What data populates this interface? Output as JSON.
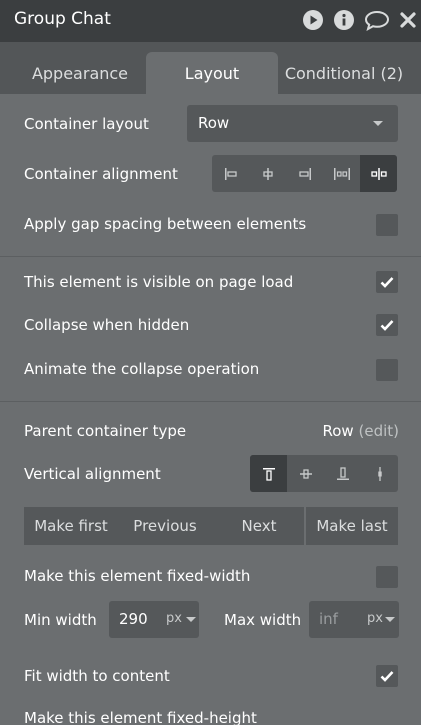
{
  "header": {
    "title": "Group Chat",
    "icons": [
      "play-icon",
      "info-icon",
      "comment-icon",
      "close-icon"
    ]
  },
  "tabs": [
    {
      "label": "Appearance",
      "active": false
    },
    {
      "label": "Layout",
      "active": true
    },
    {
      "label": "Conditional (2)",
      "active": false
    }
  ],
  "container": {
    "layout_label": "Container layout",
    "layout_value": "Row",
    "alignment_label": "Container alignment",
    "alignment_options": [
      "align-left-icon",
      "align-center-icon",
      "align-right-icon",
      "space-between-icon",
      "space-around-icon"
    ],
    "alignment_selected": "space-around-icon",
    "gap_label": "Apply gap spacing between elements",
    "gap_checked": false
  },
  "visibility": {
    "visible_label": "This element is visible on page load",
    "visible_checked": true,
    "collapse_label": "Collapse when hidden",
    "collapse_checked": true,
    "animate_label": "Animate the collapse operation",
    "animate_checked": false
  },
  "parent": {
    "type_label": "Parent container type",
    "type_value": "Row",
    "edit_label": "(edit)",
    "valign_label": "Vertical alignment",
    "valign_options": [
      "align-top-icon",
      "align-middle-icon",
      "align-bottom-icon",
      "align-stretch-icon"
    ],
    "valign_selected": "align-top-icon"
  },
  "order_buttons": [
    "Make first",
    "Previous",
    "Next",
    "Make last"
  ],
  "width": {
    "fixed_label": "Make this element fixed-width",
    "fixed_checked": false,
    "min_label": "Min width",
    "min_value": "290",
    "min_unit": "px",
    "max_label": "Max width",
    "max_placeholder": "inf",
    "max_unit": "px",
    "fit_label": "Fit width to content",
    "fit_checked": true
  },
  "height": {
    "fixed_label": "Make this element fixed-height"
  },
  "colors": {
    "panel": "#6b6e70",
    "header": "#3b3e40",
    "control": "#55585a"
  }
}
